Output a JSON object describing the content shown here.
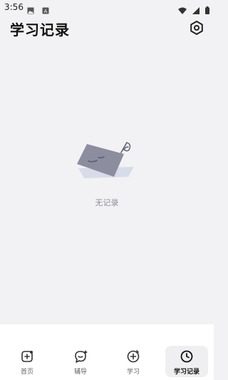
{
  "status_bar": {
    "time": "3:56",
    "left_icons": [
      "image-icon",
      "a-icon"
    ],
    "right_icons": [
      "wifi-icon",
      "signal-icon",
      "battery-icon"
    ]
  },
  "header": {
    "title": "学习记录",
    "settings_icon": "settings-hexagon-icon"
  },
  "empty_state": {
    "illustration": "paper-with-pen-illustration",
    "text": "无记录"
  },
  "bottom_nav": {
    "items": [
      {
        "label": "首页",
        "icon": "home-plus-icon"
      },
      {
        "label": "辅导",
        "icon": "chat-sparkle-icon"
      },
      {
        "label": "学习",
        "icon": "compass-plus-icon"
      },
      {
        "label": "学习记录",
        "icon": "clock-icon"
      }
    ],
    "active_index": 3
  },
  "colors": {
    "background": "#F2F2F4",
    "nav_background": "#FFFFFF",
    "active_nav_bg": "#EFEFF1",
    "empty_text": "#8E8E96"
  }
}
